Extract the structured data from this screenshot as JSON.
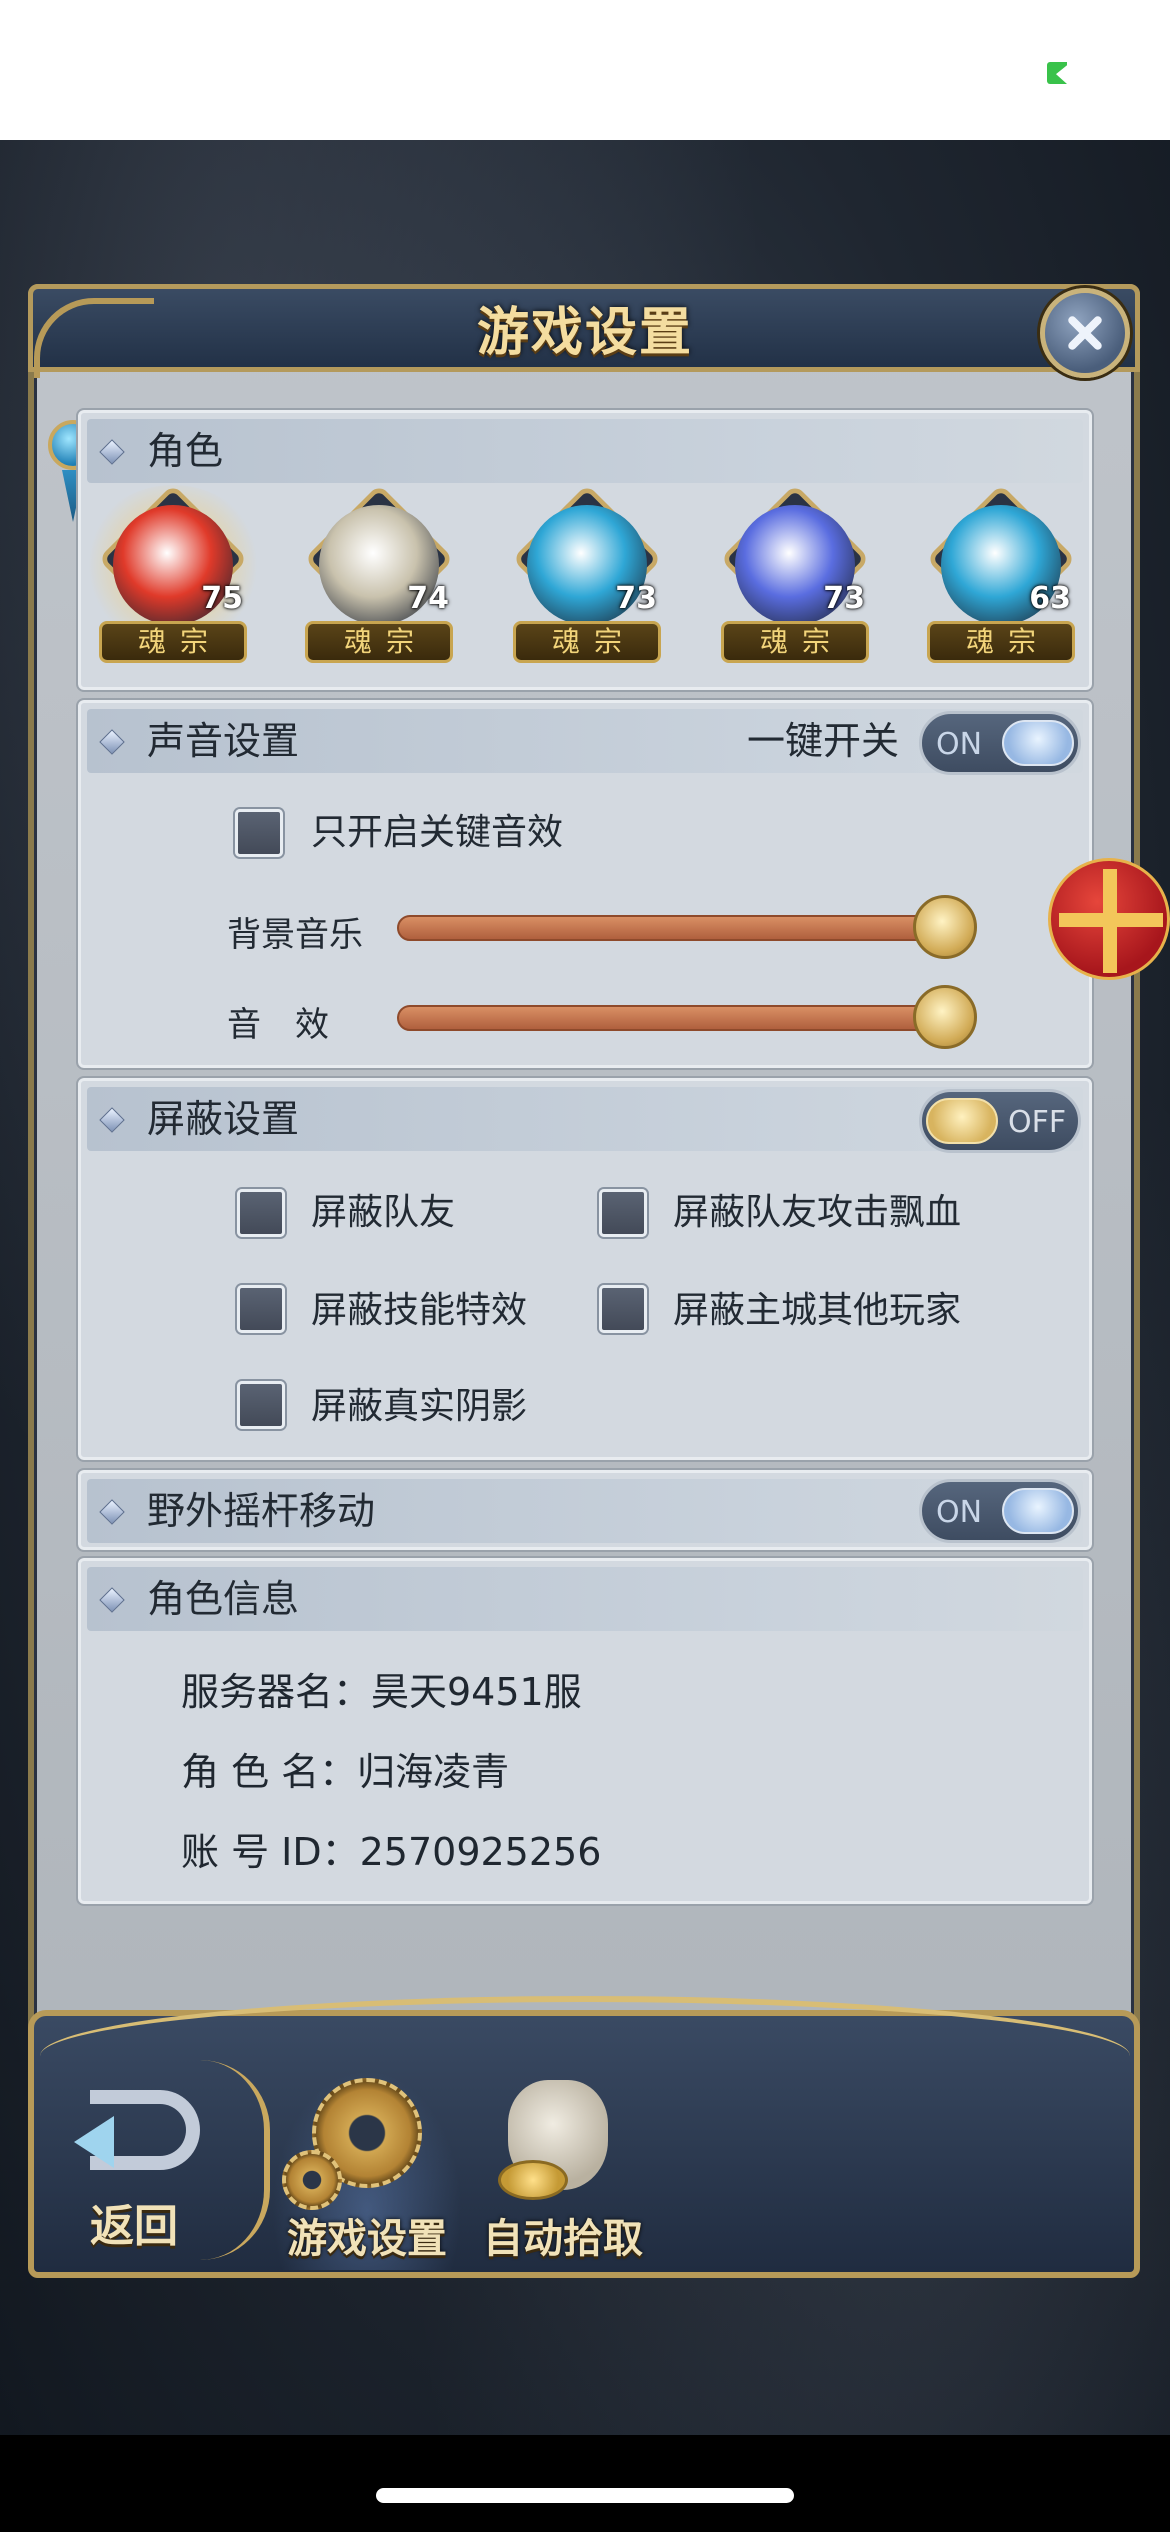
{
  "dialog": {
    "title": "游戏设置"
  },
  "role": {
    "title": "角色",
    "heroes": [
      {
        "level": "75",
        "sect": "魂宗",
        "selected": true,
        "color": "#e03a2a"
      },
      {
        "level": "74",
        "sect": "魂宗",
        "selected": false,
        "color": "#c9c2ad"
      },
      {
        "level": "73",
        "sect": "魂宗",
        "selected": false,
        "color": "#2fa7d6"
      },
      {
        "level": "73",
        "sect": "魂宗",
        "selected": false,
        "color": "#5a6de0"
      },
      {
        "level": "63",
        "sect": "魂宗",
        "selected": false,
        "color": "#2fa7d6"
      }
    ]
  },
  "sound": {
    "title": "声音设置",
    "master_label": "一键开关",
    "master_toggle": "ON",
    "key_sfx_only": "只开启关键音效",
    "bgm_label": "背景音乐",
    "bgm_level": 1.0,
    "sfx_label": "音　效",
    "sfx_level": 1.0
  },
  "block": {
    "title": "屏蔽设置",
    "toggle": "OFF",
    "options": [
      "屏蔽队友",
      "屏蔽队友攻击飘血",
      "屏蔽技能特效",
      "屏蔽主城其他玩家",
      "屏蔽真实阴影"
    ]
  },
  "joystick": {
    "title": "野外摇杆移动",
    "toggle": "ON"
  },
  "info": {
    "title": "角色信息",
    "server": "服务器名：昊天9451服",
    "role_name": "角 色 名：归海凌青",
    "account": "账 号 ID：2570925256"
  },
  "dock": {
    "back": "返回",
    "game_settings": "游戏设置",
    "auto_pickup": "自动拾取"
  }
}
